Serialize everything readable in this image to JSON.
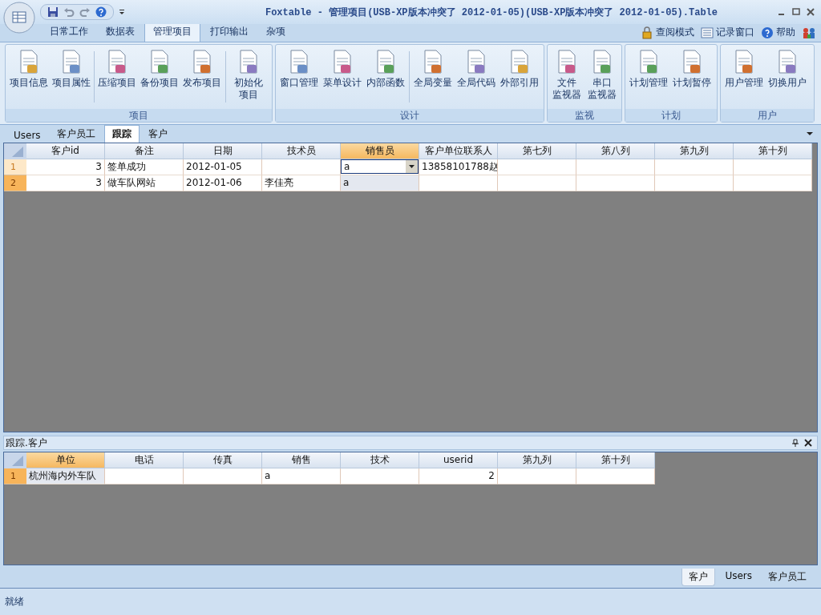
{
  "window": {
    "title": "Foxtable - 管理项目(USB-XP版本冲突了 2012-01-05)(USB-XP版本冲突了 2012-01-05).Table"
  },
  "menu_tabs": [
    {
      "label": "日常工作",
      "selected": false
    },
    {
      "label": "数据表",
      "selected": false
    },
    {
      "label": "管理项目",
      "selected": true
    },
    {
      "label": "打印输出",
      "selected": false
    },
    {
      "label": "杂项",
      "selected": false
    }
  ],
  "top_links": [
    {
      "label": "查阅模式",
      "kind": "lock"
    },
    {
      "label": "记录窗口",
      "kind": "list"
    },
    {
      "label": "帮助",
      "kind": "help"
    }
  ],
  "ribbon_groups": [
    {
      "label": "项目",
      "buttons": [
        {
          "label": "项目信息",
          "separator_before": false
        },
        {
          "label": "项目属性",
          "separator_before": false
        },
        {
          "label": "压缩项目",
          "separator_before": true
        },
        {
          "label": "备份项目",
          "separator_before": false
        },
        {
          "label": "发布项目",
          "separator_before": false
        },
        {
          "label": "初始化",
          "label_line_2": "项目",
          "separator_before": true
        }
      ]
    },
    {
      "label": "设计",
      "buttons": [
        {
          "label": "窗口管理",
          "separator_before": false
        },
        {
          "label": "菜单设计",
          "separator_before": false
        },
        {
          "label": "内部函数",
          "separator_before": false
        },
        {
          "label": "全局变量",
          "separator_before": true
        },
        {
          "label": "全局代码",
          "separator_before": false
        },
        {
          "label": "外部引用",
          "separator_before": false
        }
      ]
    },
    {
      "label": "监视",
      "buttons": [
        {
          "label": "文件",
          "label_line_2": "监视器",
          "separator_before": false
        },
        {
          "label": "串口",
          "label_line_2": "监视器",
          "separator_before": false
        }
      ]
    },
    {
      "label": "计划",
      "buttons": [
        {
          "label": "计划管理",
          "separator_before": false
        },
        {
          "label": "计划暂停",
          "separator_before": false
        }
      ]
    },
    {
      "label": "用户",
      "buttons": [
        {
          "label": "用户管理",
          "separator_before": false
        },
        {
          "label": "切换用户",
          "separator_before": false
        }
      ]
    }
  ],
  "sheet_tabs": [
    {
      "label": "Users",
      "selected": false
    },
    {
      "label": "客户员工",
      "selected": false
    },
    {
      "label": "跟踪",
      "selected": true
    },
    {
      "label": "客户",
      "selected": false
    }
  ],
  "main_table": {
    "columns": [
      {
        "label": "客户id",
        "selected": false,
        "numeric": true
      },
      {
        "label": "备注",
        "selected": false
      },
      {
        "label": "日期",
        "selected": false
      },
      {
        "label": "技术员",
        "selected": false
      },
      {
        "label": "销售员",
        "selected": true
      },
      {
        "label": "客户单位联系人",
        "selected": false
      },
      {
        "label": "第七列",
        "selected": false
      },
      {
        "label": "第八列",
        "selected": false
      },
      {
        "label": "第九列",
        "selected": false
      },
      {
        "label": "第十列",
        "selected": false
      }
    ],
    "rows": [
      {
        "number": "1",
        "selected": false,
        "editing": true,
        "cells": [
          "3",
          "签单成功",
          "2012-01-05",
          "",
          "a",
          "13858101788赵",
          "",
          "",
          "",
          ""
        ]
      },
      {
        "number": "2",
        "selected": true,
        "editing": false,
        "cells": [
          "3",
          "做车队网站",
          "2012-01-06",
          "李佳亮",
          "a",
          "",
          "",
          "",
          "",
          ""
        ]
      }
    ]
  },
  "detail_panel": {
    "title": "跟踪.客户",
    "table": {
      "columns": [
        {
          "label": "单位",
          "selected": true
        },
        {
          "label": "电话",
          "selected": false
        },
        {
          "label": "传真",
          "selected": false
        },
        {
          "label": "销售",
          "selected": false
        },
        {
          "label": "技术",
          "selected": false
        },
        {
          "label": "userid",
          "selected": false,
          "numeric": true
        },
        {
          "label": "第九列",
          "selected": false
        },
        {
          "label": "第十列",
          "selected": false
        }
      ],
      "rows": [
        {
          "number": "1",
          "selected": true,
          "editing": false,
          "cells": [
            "杭州海内外车队",
            "",
            "",
            "a",
            "",
            "2",
            "",
            ""
          ]
        }
      ]
    }
  },
  "bottom_tabs": [
    {
      "label": "客户",
      "selected": true
    },
    {
      "label": "Users",
      "selected": false
    },
    {
      "label": "客户员工",
      "selected": false
    }
  ],
  "status_bar": {
    "text": "就绪"
  }
}
